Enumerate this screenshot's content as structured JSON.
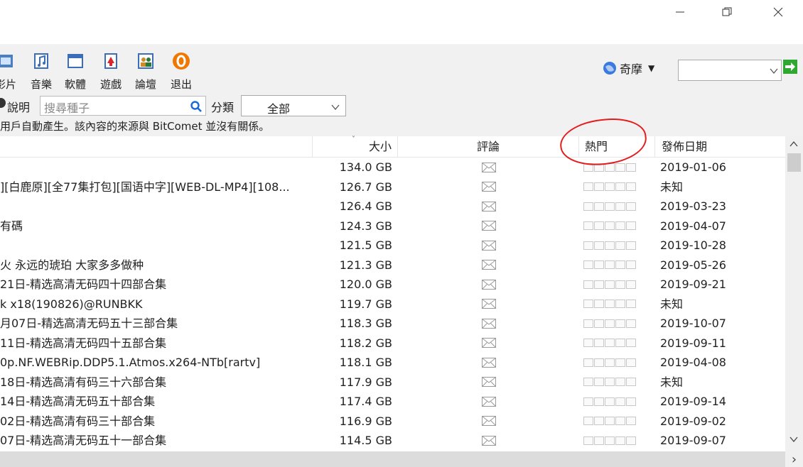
{
  "window_controls": {
    "minimize": "—",
    "restore": "❐",
    "close": "✕"
  },
  "toolbar": {
    "items": [
      {
        "label": "影片",
        "icon": "video-icon"
      },
      {
        "label": "音樂",
        "icon": "music-icon"
      },
      {
        "label": "軟體",
        "icon": "software-icon"
      },
      {
        "label": "遊戲",
        "icon": "game-icon"
      },
      {
        "label": "論壇",
        "icon": "forum-icon"
      },
      {
        "label": "退出",
        "icon": "exit-icon"
      }
    ],
    "engine_label": "奇摩",
    "search_box_value": ""
  },
  "searchrow": {
    "help_label": "說明",
    "search_placeholder": "搜尋種子",
    "category_label": "分類",
    "category_value": "全部"
  },
  "notice": "用戶自動產生。該內容的來源與 BitComet 並沒有關係。",
  "table": {
    "headers": {
      "size": "大小",
      "comments": "評論",
      "hot": "熱門",
      "date": "發佈日期"
    },
    "rows": [
      {
        "name": "",
        "size": "134.0 GB",
        "date": "2019-01-06"
      },
      {
        "name": "][白鹿原][全77集打包][国语中字][WEB-DL-MP4][108...",
        "size": "126.7 GB",
        "date": "未知"
      },
      {
        "name": "",
        "size": "126.4 GB",
        "date": "2019-03-23"
      },
      {
        "name": "有碼",
        "size": "124.3 GB",
        "date": "2019-04-07"
      },
      {
        "name": "",
        "size": "121.5 GB",
        "date": "2019-10-28"
      },
      {
        "name": "火 永远的琥珀 大家多多做种",
        "size": "121.3 GB",
        "date": "2019-05-26"
      },
      {
        "name": "21日-精选高清无码四十四部合集",
        "size": "120.0 GB",
        "date": "2019-09-21"
      },
      {
        "name": "k x18(190826)@RUNBKK",
        "size": "119.7 GB",
        "date": "未知"
      },
      {
        "name": "月07日-精选高清无码五十三部合集",
        "size": "118.3 GB",
        "date": "2019-10-07"
      },
      {
        "name": "11日-精选高清无码四十五部合集",
        "size": "118.2 GB",
        "date": "2019-09-11"
      },
      {
        "name": "0p.NF.WEBRip.DDP5.1.Atmos.x264-NTb[rartv]",
        "size": "118.1 GB",
        "date": "2019-04-08"
      },
      {
        "name": "18日-精选高清有码三十六部合集",
        "size": "117.9 GB",
        "date": "未知"
      },
      {
        "name": "14日-精选高清无码五十部合集",
        "size": "117.4 GB",
        "date": "2019-09-14"
      },
      {
        "name": "02日-精选高清有码三十部合集",
        "size": "116.9 GB",
        "date": "2019-09-02"
      },
      {
        "name": "07日-精选高清无码五十一部合集",
        "size": "114.5 GB",
        "date": "2019-09-07"
      }
    ]
  },
  "scroll": {
    "right_arrow": "›"
  },
  "colors": {
    "annotation": "#e41c1c",
    "go_arrow": "#2fa832",
    "search_icon": "#1a6ad6",
    "exit_icon": "#f07800"
  }
}
